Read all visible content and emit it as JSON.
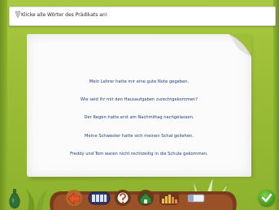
{
  "instruction": {
    "text": "Klicke alle Wörter des Prädikats an!"
  },
  "exercise": {
    "sentences": [
      "Mein Lehrer hatte mir eine gute Note gegeben.",
      "Wie seid ihr mit den Hausaufgaben zurechtgekommen?",
      "Der Regen hatte erst am Nachmittag nachgelassen.",
      "Meine Schwester hatte sich meinen Schal geliehen.",
      "Freddy und Tom waren nicht rechtzeitig in die Schule gekommen."
    ]
  },
  "toolbar": {
    "icons": [
      "back-arrow-icon",
      "keyboard-icon",
      "help-icon",
      "home-icon",
      "sound-bars-icon",
      "eraser-icon"
    ]
  },
  "ok_button": {
    "icon": "check-icon"
  },
  "colors": {
    "background": "#9dbe37",
    "sentence_text": "#1f3e78",
    "toolbar": "#7a3d1c",
    "ok_green": "#3e9a1c"
  }
}
